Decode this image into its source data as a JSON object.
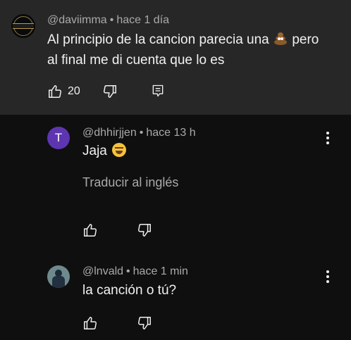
{
  "main_comment": {
    "author": "@daviimma",
    "separator": "•",
    "time": "hace 1 día",
    "text_before_emoji": "Al principio de la cancion parecia una",
    "emoji": "poop-emoji",
    "text_after_emoji": "pero",
    "text_line2": "al final me di cuenta que lo es",
    "like_count": "20"
  },
  "replies": [
    {
      "avatar_letter": "T",
      "avatar_color": "#5e35b1",
      "author": "@dhhirjjen",
      "separator": "•",
      "time": "hace 13 h",
      "text": "Jaja",
      "emoji": "laughing-emoji",
      "translate_label": "Traducir al inglés"
    },
    {
      "author": "@lnvald",
      "separator": "•",
      "time": "hace 1 min",
      "text": "la canción o tú?"
    }
  ],
  "icons": {
    "like": "thumbs-up-icon",
    "dislike": "thumbs-down-icon",
    "reply": "reply-icon",
    "more": "more-vert-icon"
  },
  "colors": {
    "background": "#0f0f0f",
    "highlight_background": "#272727",
    "primary_text": "#f1f1f1",
    "secondary_text": "#aaaaaa"
  }
}
